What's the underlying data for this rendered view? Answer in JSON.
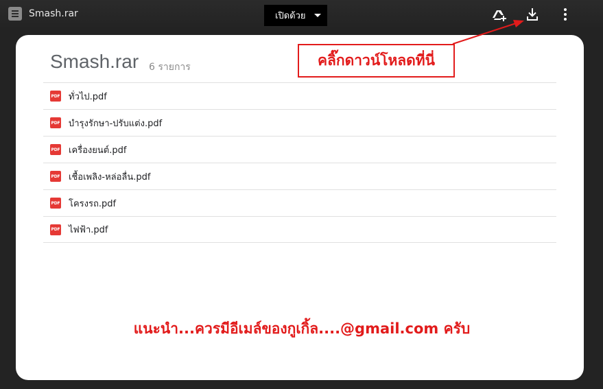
{
  "header": {
    "title": "Smash.rar",
    "open_with_label": "เปิดด้วย",
    "icons": [
      "file-icon",
      "add-to-drive-icon",
      "download-icon",
      "more-vert-icon"
    ]
  },
  "archive": {
    "name": "Smash.rar",
    "count_label": "6 รายการ",
    "pdf_badge": "PDF",
    "files": [
      {
        "name": "ทั่วไป.pdf"
      },
      {
        "name": "บำรุงรักษา-ปรับแต่ง.pdf"
      },
      {
        "name": "เครื่องยนต์.pdf"
      },
      {
        "name": "เชื้อเพลิง-หล่อลื่น.pdf"
      },
      {
        "name": "โครงรถ.pdf"
      },
      {
        "name": "ไฟฟ้า.pdf"
      }
    ]
  },
  "annotations": {
    "callout": "คลิ๊กดาวน์โหลดที่นี่",
    "bottom_note": "แนะนำ...ควรมีอีเมล์ของกูเกิ้ล....@gmail.com ครับ",
    "accent_color": "#e21b1b"
  }
}
